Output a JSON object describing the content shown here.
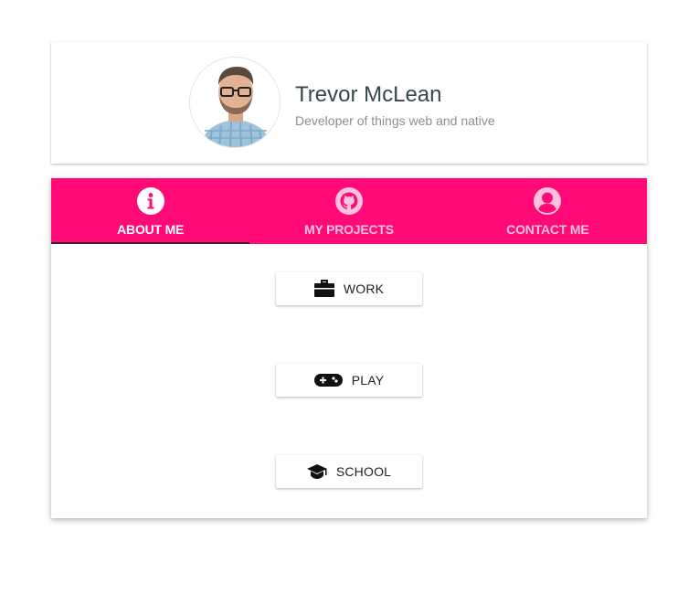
{
  "profile": {
    "name": "Trevor McLean",
    "tagline": "Developer of things web and native",
    "avatar_icon": "avatar-photo"
  },
  "colors": {
    "accent": "#ff0a77",
    "tab_active_text": "#ffffff",
    "tab_inactive_text": "#ffc2dc",
    "indicator": "#3a1f2c"
  },
  "tabs": [
    {
      "label": "ABOUT ME",
      "icon": "info-icon",
      "active": true
    },
    {
      "label": "MY PROJECTS",
      "icon": "github-icon",
      "active": false
    },
    {
      "label": "CONTACT ME",
      "icon": "person-icon",
      "active": false
    }
  ],
  "buttons": [
    {
      "label": "WORK",
      "icon": "briefcase-icon"
    },
    {
      "label": "PLAY",
      "icon": "gamepad-icon"
    },
    {
      "label": "SCHOOL",
      "icon": "graduation-cap-icon"
    }
  ]
}
